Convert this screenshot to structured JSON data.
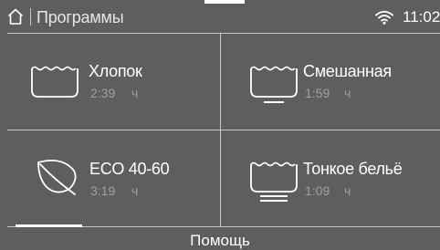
{
  "header": {
    "title": "Программы",
    "time": "11:02",
    "home_icon": "home-icon",
    "wifi_icon": "wifi-icon"
  },
  "programs": [
    {
      "name": "Хлопок",
      "duration": "2:39",
      "unit": "ч",
      "icon": "basin-cotton-icon"
    },
    {
      "name": "Смешанная",
      "duration": "1:59",
      "unit": "ч",
      "icon": "basin-mixed-icon"
    },
    {
      "name": "ECO 40-60",
      "duration": "3:19",
      "unit": "ч",
      "icon": "leaf-icon"
    },
    {
      "name": "Тонкое бельё",
      "duration": "1:09",
      "unit": "ч",
      "icon": "basin-delicates-icon"
    }
  ],
  "footer": {
    "help_label": "Помощь"
  }
}
